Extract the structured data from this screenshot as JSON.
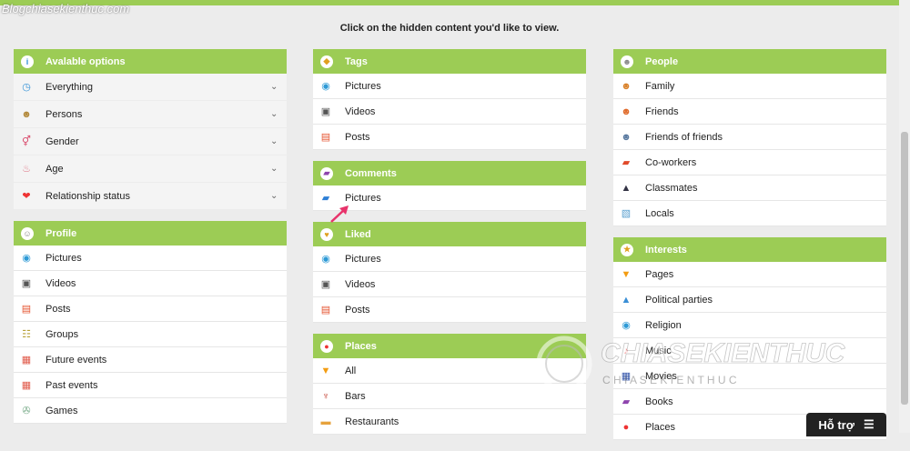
{
  "watermark_top": "Blogchiasekienthuc.com",
  "instruction": "Click on the hidden content you'd like to view.",
  "options": {
    "title": "Avalable options",
    "items": [
      {
        "label": "Everything",
        "icon": "clock-icon",
        "glyph": "◷",
        "color": "#2e8fd6"
      },
      {
        "label": "Persons",
        "icon": "persons-icon",
        "glyph": "☻",
        "color": "#b38a3c"
      },
      {
        "label": "Gender",
        "icon": "gender-icon",
        "glyph": "⚥",
        "color": "#d94a6b"
      },
      {
        "label": "Age",
        "icon": "cake-icon",
        "glyph": "♨",
        "color": "#e07a8a"
      },
      {
        "label": "Relationship status",
        "icon": "heart-icon",
        "glyph": "❤",
        "color": "#e33"
      }
    ]
  },
  "profile": {
    "title": "Profile",
    "items": [
      {
        "label": "Pictures",
        "icon": "camera-icon",
        "glyph": "◉",
        "color": "#2e9ad6"
      },
      {
        "label": "Videos",
        "icon": "video-camera-icon",
        "glyph": "▣",
        "color": "#555"
      },
      {
        "label": "Posts",
        "icon": "posts-icon",
        "glyph": "▤",
        "color": "#e5532f"
      },
      {
        "label": "Groups",
        "icon": "groups-icon",
        "glyph": "☷",
        "color": "#b8a23a"
      },
      {
        "label": "Future events",
        "icon": "calendar-icon",
        "glyph": "▦",
        "color": "#e05a4a"
      },
      {
        "label": "Past events",
        "icon": "calendar-past-icon",
        "glyph": "▦",
        "color": "#e05a4a"
      },
      {
        "label": "Games",
        "icon": "games-icon",
        "glyph": "✇",
        "color": "#7a8"
      }
    ]
  },
  "tags": {
    "title": "Tags",
    "items": [
      {
        "label": "Pictures",
        "icon": "camera-icon",
        "glyph": "◉",
        "color": "#2e9ad6"
      },
      {
        "label": "Videos",
        "icon": "video-camera-icon",
        "glyph": "▣",
        "color": "#555"
      },
      {
        "label": "Posts",
        "icon": "posts-icon",
        "glyph": "▤",
        "color": "#e5532f"
      }
    ]
  },
  "comments": {
    "title": "Comments",
    "items": [
      {
        "label": "Pictures",
        "icon": "comment-bubble-icon",
        "glyph": "▰",
        "color": "#2e7fd6"
      }
    ]
  },
  "liked": {
    "title": "Liked",
    "items": [
      {
        "label": "Pictures",
        "icon": "camera-icon",
        "glyph": "◉",
        "color": "#2e9ad6"
      },
      {
        "label": "Videos",
        "icon": "video-camera-icon",
        "glyph": "▣",
        "color": "#555"
      },
      {
        "label": "Posts",
        "icon": "posts-icon",
        "glyph": "▤",
        "color": "#e5532f"
      }
    ]
  },
  "places": {
    "title": "Places",
    "items": [
      {
        "label": "All",
        "icon": "filter-icon",
        "glyph": "▼",
        "color": "#f39c12"
      },
      {
        "label": "Bars",
        "icon": "drink-icon",
        "glyph": "♆",
        "color": "#c0392b"
      },
      {
        "label": "Restaurants",
        "icon": "restaurant-icon",
        "glyph": "▬",
        "color": "#e6a23c"
      }
    ]
  },
  "people": {
    "title": "People",
    "items": [
      {
        "label": "Family",
        "icon": "family-icon",
        "glyph": "☻",
        "color": "#d9822b"
      },
      {
        "label": "Friends",
        "icon": "friends-icon",
        "glyph": "☻",
        "color": "#e06a2a"
      },
      {
        "label": "Friends of friends",
        "icon": "friends-of-friends-icon",
        "glyph": "☻",
        "color": "#5a7aa0"
      },
      {
        "label": "Co-workers",
        "icon": "briefcase-icon",
        "glyph": "▰",
        "color": "#e04a2a"
      },
      {
        "label": "Classmates",
        "icon": "graduation-cap-icon",
        "glyph": "▲",
        "color": "#334"
      },
      {
        "label": "Locals",
        "icon": "map-icon",
        "glyph": "▧",
        "color": "#5aa0d0"
      }
    ]
  },
  "interests": {
    "title": "Interests",
    "items": [
      {
        "label": "Pages",
        "icon": "pages-filter-icon",
        "glyph": "▼",
        "color": "#f39c12"
      },
      {
        "label": "Political parties",
        "icon": "political-icon",
        "glyph": "▲",
        "color": "#3a8fd6"
      },
      {
        "label": "Religion",
        "icon": "religion-icon",
        "glyph": "◉",
        "color": "#2e9ad6"
      },
      {
        "label": "Music",
        "icon": "music-icon",
        "glyph": "♪",
        "color": "#e33"
      },
      {
        "label": "Movies",
        "icon": "movies-icon",
        "glyph": "▦",
        "color": "#3355aa"
      },
      {
        "label": "Books",
        "icon": "book-icon",
        "glyph": "▰",
        "color": "#8e44ad"
      },
      {
        "label": "Places",
        "icon": "place-pin-icon",
        "glyph": "●",
        "color": "#e33"
      }
    ]
  },
  "support_label": "Hỗ trợ",
  "watermark_brand": "CHIASEKIENTHUC",
  "watermark_sub": "C H I A   S E   K I E N   T H U C"
}
